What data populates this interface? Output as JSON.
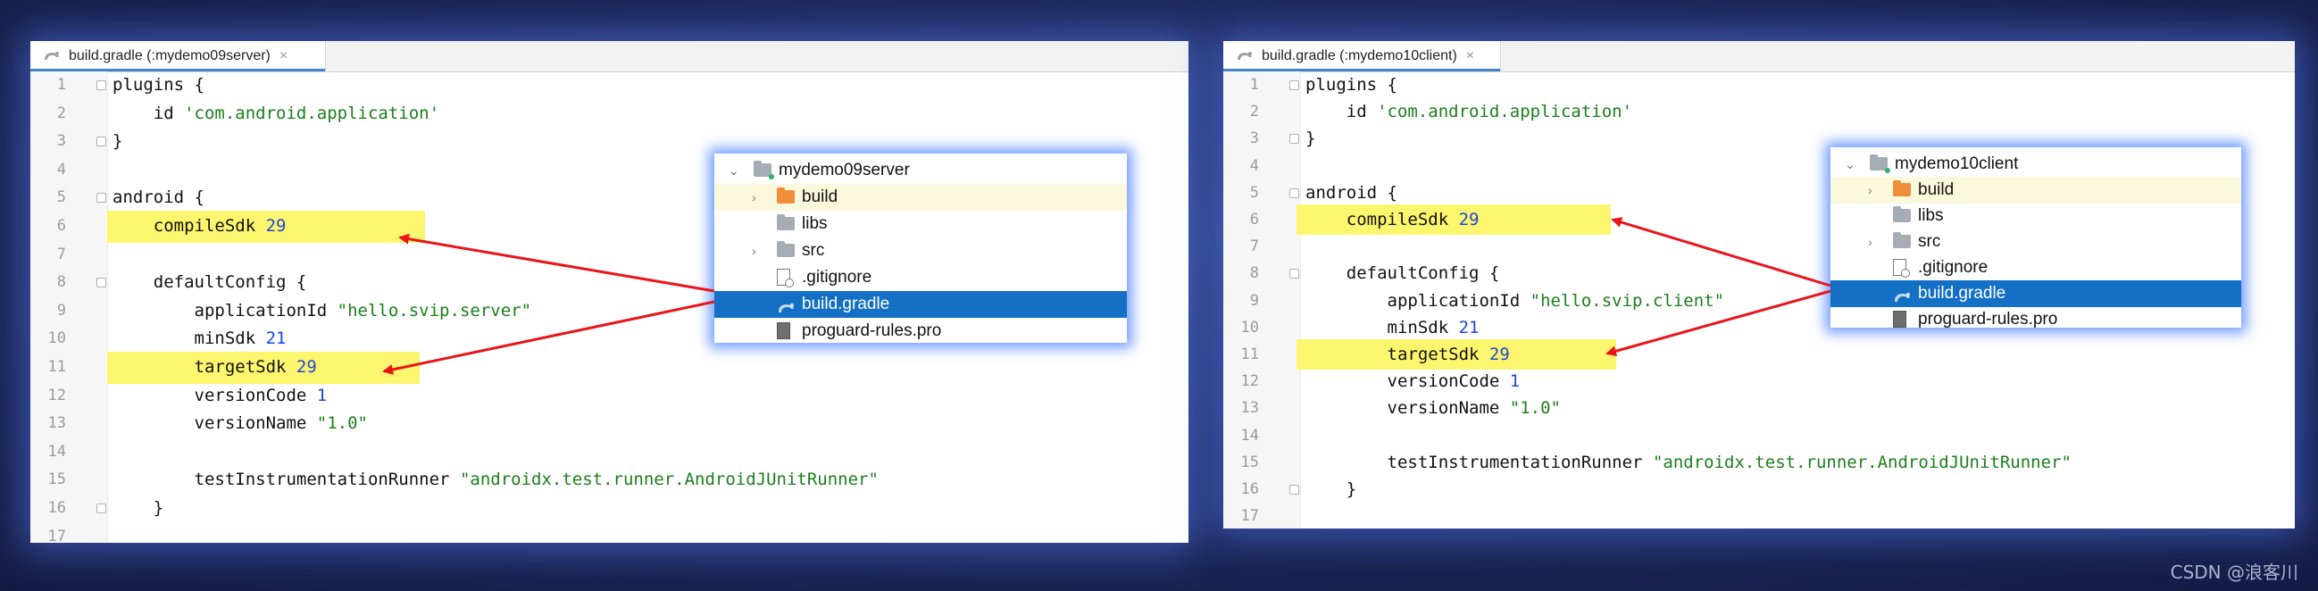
{
  "left": {
    "tab_title": "build.gradle (:mydemo09server)",
    "tab_close": "×",
    "code_lines": [
      {
        "num": "1",
        "fold": true,
        "segs": [
          {
            "t": "plugins {",
            "c": ""
          }
        ]
      },
      {
        "num": "2",
        "fold": false,
        "segs": [
          {
            "t": "    id ",
            "c": ""
          },
          {
            "t": "'com.android.application'",
            "c": "str"
          }
        ]
      },
      {
        "num": "3",
        "fold": true,
        "segs": [
          {
            "t": "}",
            "c": ""
          }
        ]
      },
      {
        "num": "4",
        "fold": false,
        "segs": []
      },
      {
        "num": "5",
        "fold": true,
        "segs": [
          {
            "t": "android {",
            "c": ""
          }
        ]
      },
      {
        "num": "6",
        "fold": false,
        "hl": true,
        "segs": [
          {
            "t": "    compileSdk ",
            "c": ""
          },
          {
            "t": "29",
            "c": "num"
          }
        ]
      },
      {
        "num": "7",
        "fold": false,
        "segs": []
      },
      {
        "num": "8",
        "fold": true,
        "segs": [
          {
            "t": "    defaultConfig {",
            "c": ""
          }
        ]
      },
      {
        "num": "9",
        "fold": false,
        "segs": [
          {
            "t": "        applicationId ",
            "c": ""
          },
          {
            "t": "\"hello.svip.server\"",
            "c": "str"
          }
        ]
      },
      {
        "num": "10",
        "fold": false,
        "segs": [
          {
            "t": "        minSdk ",
            "c": ""
          },
          {
            "t": "21",
            "c": "num"
          }
        ]
      },
      {
        "num": "11",
        "fold": false,
        "hl": true,
        "segs": [
          {
            "t": "        targetSdk ",
            "c": ""
          },
          {
            "t": "29",
            "c": "num"
          }
        ]
      },
      {
        "num": "12",
        "fold": false,
        "segs": [
          {
            "t": "        versionCode ",
            "c": ""
          },
          {
            "t": "1",
            "c": "num"
          }
        ]
      },
      {
        "num": "13",
        "fold": false,
        "segs": [
          {
            "t": "        versionName ",
            "c": ""
          },
          {
            "t": "\"1.0\"",
            "c": "str"
          }
        ]
      },
      {
        "num": "14",
        "fold": false,
        "segs": []
      },
      {
        "num": "15",
        "fold": false,
        "segs": [
          {
            "t": "        testInstrumentationRunner ",
            "c": ""
          },
          {
            "t": "\"androidx.test.runner.AndroidJUnitRunner\"",
            "c": "str"
          }
        ]
      },
      {
        "num": "16",
        "fold": true,
        "segs": [
          {
            "t": "    }",
            "c": ""
          }
        ]
      },
      {
        "num": "17",
        "fold": false,
        "segs": []
      }
    ],
    "tree": [
      {
        "label": "mydemo09server",
        "icon": "module-folder-icon",
        "chevron": "⌄",
        "state": ""
      },
      {
        "label": "build",
        "icon": "build-folder-icon",
        "chevron": "›",
        "state": "hover"
      },
      {
        "label": "libs",
        "icon": "folder-icon",
        "chevron": "",
        "state": ""
      },
      {
        "label": "src",
        "icon": "folder-icon",
        "chevron": "›",
        "state": ""
      },
      {
        "label": ".gitignore",
        "icon": "gitignore-file-icon",
        "chevron": "",
        "state": ""
      },
      {
        "label": "build.gradle",
        "icon": "gradle-icon",
        "chevron": "",
        "state": "sel"
      },
      {
        "label": "proguard-rules.pro",
        "icon": "file-icon",
        "chevron": "",
        "state": ""
      }
    ]
  },
  "right": {
    "tab_title": "build.gradle (:mydemo10client)",
    "tab_close": "×",
    "code_lines": [
      {
        "num": "1",
        "fold": true,
        "segs": [
          {
            "t": "plugins {",
            "c": ""
          }
        ]
      },
      {
        "num": "2",
        "fold": false,
        "segs": [
          {
            "t": "    id ",
            "c": ""
          },
          {
            "t": "'com.android.application'",
            "c": "str"
          }
        ]
      },
      {
        "num": "3",
        "fold": true,
        "segs": [
          {
            "t": "}",
            "c": ""
          }
        ]
      },
      {
        "num": "4",
        "fold": false,
        "segs": []
      },
      {
        "num": "5",
        "fold": true,
        "segs": [
          {
            "t": "android {",
            "c": ""
          }
        ]
      },
      {
        "num": "6",
        "fold": false,
        "hl": true,
        "segs": [
          {
            "t": "    compileSdk ",
            "c": ""
          },
          {
            "t": "29",
            "c": "num"
          }
        ]
      },
      {
        "num": "7",
        "fold": false,
        "segs": []
      },
      {
        "num": "8",
        "fold": true,
        "segs": [
          {
            "t": "    defaultConfig {",
            "c": ""
          }
        ]
      },
      {
        "num": "9",
        "fold": false,
        "segs": [
          {
            "t": "        applicationId ",
            "c": ""
          },
          {
            "t": "\"hello.svip.client\"",
            "c": "str"
          }
        ]
      },
      {
        "num": "10",
        "fold": false,
        "segs": [
          {
            "t": "        minSdk ",
            "c": ""
          },
          {
            "t": "21",
            "c": "num"
          }
        ]
      },
      {
        "num": "11",
        "fold": false,
        "hl": true,
        "segs": [
          {
            "t": "        targetSdk ",
            "c": ""
          },
          {
            "t": "29",
            "c": "num"
          }
        ]
      },
      {
        "num": "12",
        "fold": false,
        "segs": [
          {
            "t": "        versionCode ",
            "c": ""
          },
          {
            "t": "1",
            "c": "num"
          }
        ]
      },
      {
        "num": "13",
        "fold": false,
        "segs": [
          {
            "t": "        versionName ",
            "c": ""
          },
          {
            "t": "\"1.0\"",
            "c": "str"
          }
        ]
      },
      {
        "num": "14",
        "fold": false,
        "segs": []
      },
      {
        "num": "15",
        "fold": false,
        "segs": [
          {
            "t": "        testInstrumentationRunner ",
            "c": ""
          },
          {
            "t": "\"androidx.test.runner.AndroidJUnitRunner\"",
            "c": "str"
          }
        ]
      },
      {
        "num": "16",
        "fold": true,
        "segs": [
          {
            "t": "    }",
            "c": ""
          }
        ]
      },
      {
        "num": "17",
        "fold": false,
        "segs": []
      }
    ],
    "tree": [
      {
        "label": "mydemo10client",
        "icon": "module-folder-icon",
        "chevron": "⌄",
        "state": ""
      },
      {
        "label": "build",
        "icon": "build-folder-icon",
        "chevron": "›",
        "state": "hover"
      },
      {
        "label": "libs",
        "icon": "folder-icon",
        "chevron": "",
        "state": ""
      },
      {
        "label": "src",
        "icon": "folder-icon",
        "chevron": "›",
        "state": ""
      },
      {
        "label": ".gitignore",
        "icon": "gitignore-file-icon",
        "chevron": "",
        "state": ""
      },
      {
        "label": "build.gradle",
        "icon": "gradle-icon",
        "chevron": "",
        "state": "sel"
      },
      {
        "label": "proguard-rules.pro",
        "icon": "file-icon",
        "chevron": "",
        "state": ""
      }
    ]
  },
  "watermark": "CSDN @浪客川",
  "colors": {
    "highlight": "#fcf56e",
    "selection": "#1370c4",
    "arrow": "#e8151b",
    "string": "#1a7f1a",
    "number": "#1d48d8"
  }
}
